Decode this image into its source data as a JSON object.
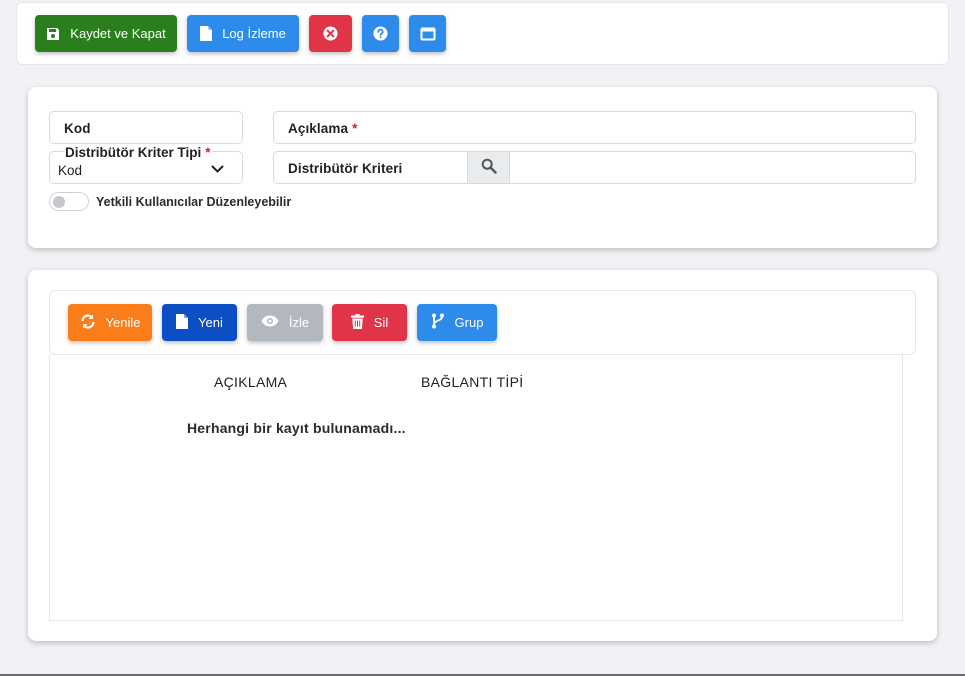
{
  "toolbar": {
    "save_close_label": "Kaydet ve Kapat",
    "log_label": "Log İzleme"
  },
  "form": {
    "kod_label": "Kod",
    "aciklama_label": "Açıklama",
    "required_mark": "*",
    "tip_label": "Distribütör Kriter Tipi",
    "tip_value": "Kod",
    "kriter_label": "Distribütör Kriteri",
    "kriter_value": "",
    "toggle_label": "Yetkili Kullanıcılar Düzenleyebilir",
    "toggle_on": false
  },
  "grid": {
    "buttons": {
      "refresh": "Yenile",
      "new": "Yeni",
      "view": "İzle",
      "delete": "Sil",
      "group": "Grup"
    },
    "columns": [
      "AÇIKLAMA",
      "BAĞLANTI TİPİ"
    ],
    "empty_message": "Herhangi bir kayıt bulunamadı..."
  },
  "colors": {
    "green": "#2a7f1c",
    "blue": "#2d8ceb",
    "red": "#e03548",
    "orange": "#fb7d1a",
    "navy": "#0c4fc4",
    "gray": "#b3b8c0"
  }
}
